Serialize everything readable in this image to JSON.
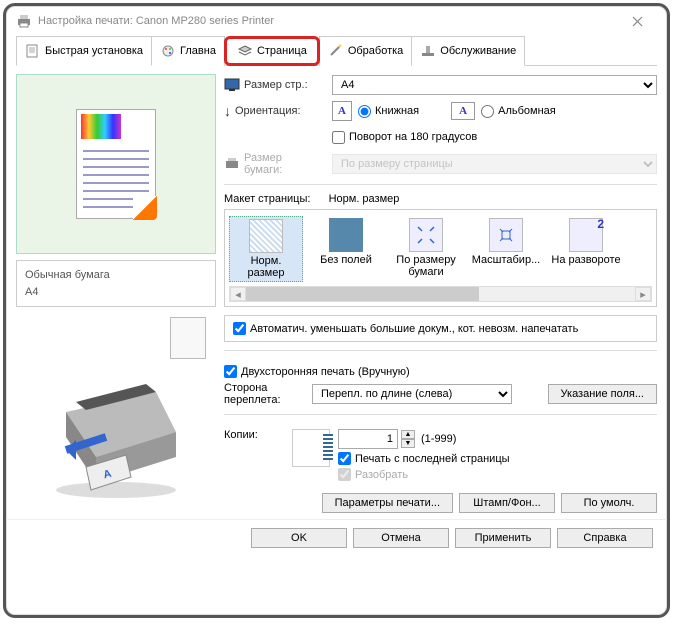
{
  "title": "Настройка печати: Canon MP280 series Printer",
  "tabs": {
    "quick": "Быстрая установка",
    "main": "Главна",
    "page": "Страница",
    "process": "Обработка",
    "service": "Обслуживание"
  },
  "left": {
    "paper_type": "Обычная бумага",
    "paper_size": "A4"
  },
  "page_size": {
    "label": "Размер стр.:",
    "value": "A4"
  },
  "orient": {
    "label": "Ориентация:",
    "portrait": "Книжная",
    "landscape": "Альбомная",
    "rotate180": "Поворот на 180 градусов"
  },
  "paper": {
    "label_ln1": "Размер",
    "label_ln2": "бумаги:",
    "value": "По размеру страницы"
  },
  "layout": {
    "label": "Макет страницы:",
    "current": "Норм. размер",
    "items": [
      "Норм. размер",
      "Без полей",
      "По размеру бумаги",
      "Масштабир...",
      "На развороте"
    ]
  },
  "auto_reduce": "Автоматич. уменьшать большие докум., кот. невозм. напечатать",
  "duplex": {
    "label": "Двухсторонняя печать (Вручную)",
    "side_ln1": "Сторона",
    "side_ln2": "переплета:",
    "value": "Перепл. по длине (слева)",
    "margin_btn": "Указание поля..."
  },
  "copies": {
    "label": "Копии:",
    "value": "1",
    "range": "(1-999)",
    "from_last": "Печать с последней страницы",
    "collate": "Разобрать"
  },
  "bottom_buttons": {
    "print_params": "Параметры печати...",
    "stamp": "Штамп/Фон...",
    "defaults": "По умолч."
  },
  "footer": {
    "ok": "OK",
    "cancel": "Отмена",
    "apply": "Применить",
    "help": "Справка"
  }
}
